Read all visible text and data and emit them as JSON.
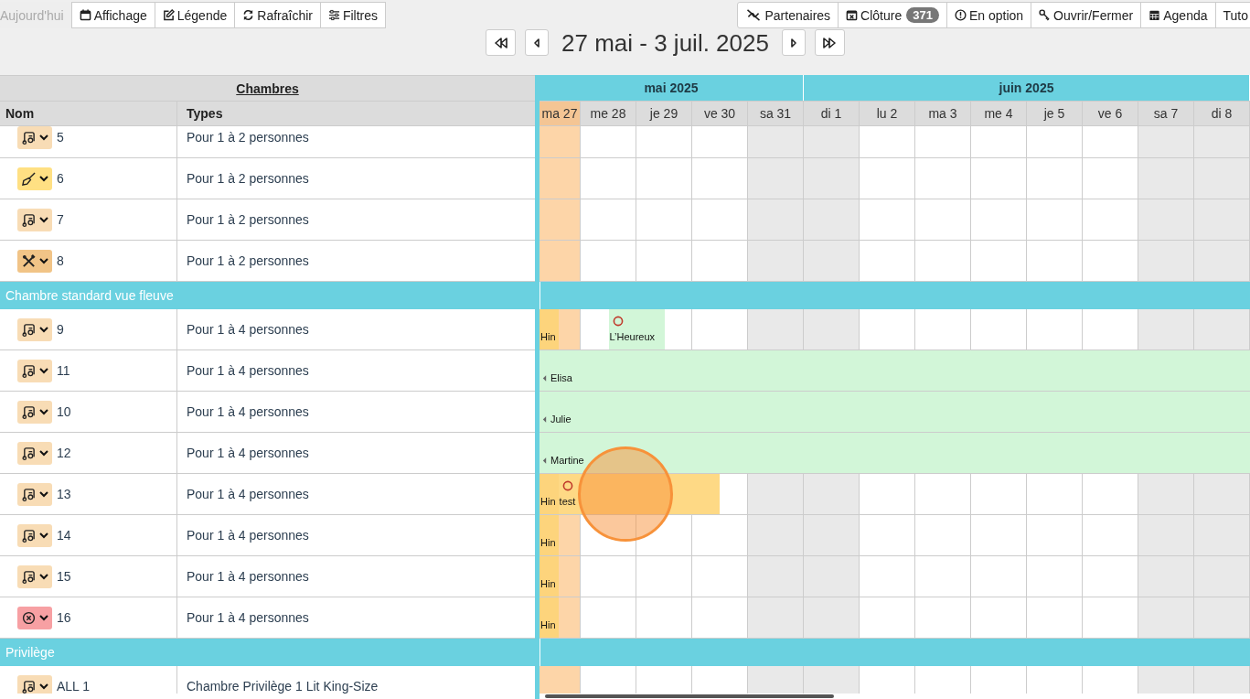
{
  "toolbar_left": [
    {
      "label": "Aujourd'hui",
      "disabled": true
    },
    {
      "label": "Affichage",
      "disabled": false
    },
    {
      "label": "Légende",
      "disabled": false
    },
    {
      "label": "Rafraîchir",
      "disabled": false
    },
    {
      "label": "Filtres",
      "disabled": false
    }
  ],
  "toolbar_right": [
    {
      "label": "Partenaires"
    },
    {
      "label": "Clôture",
      "badge": "371"
    },
    {
      "label": "En option"
    },
    {
      "label": "Ouvrir/Fermer"
    },
    {
      "label": "Agenda"
    },
    {
      "label": "Tuto"
    }
  ],
  "period": {
    "title": "27 mai - 3 juil. 2025"
  },
  "table": {
    "title": "Chambres",
    "columns": [
      "Nom",
      "Types"
    ]
  },
  "months": [
    {
      "label": "mai 2025",
      "days": [
        {
          "label": "ma 27",
          "today": true,
          "weekend": false
        },
        {
          "label": "me 28",
          "today": false,
          "weekend": false
        },
        {
          "label": "je 29",
          "today": false,
          "weekend": false
        },
        {
          "label": "ve 30",
          "today": false,
          "weekend": false
        },
        {
          "label": "sa 31",
          "today": false,
          "weekend": true
        }
      ]
    },
    {
      "label": "juin 2025",
      "days": [
        {
          "label": "di 1",
          "today": false,
          "weekend": true
        },
        {
          "label": "lu 2",
          "today": false,
          "weekend": false
        },
        {
          "label": "ma 3",
          "today": false,
          "weekend": false
        },
        {
          "label": "me 4",
          "today": false,
          "weekend": false
        },
        {
          "label": "je 5",
          "today": false,
          "weekend": false
        },
        {
          "label": "ve 6",
          "today": false,
          "weekend": false
        },
        {
          "label": "sa 7",
          "today": false,
          "weekend": true
        },
        {
          "label": "di 8",
          "today": false,
          "weekend": true
        }
      ]
    }
  ],
  "rows": [
    {
      "kind": "room",
      "name": "5",
      "type": "Pour 1 à 2 personnes",
      "status": {
        "kind": "vacuum",
        "color": "#f8dcb5"
      },
      "bookings": []
    },
    {
      "kind": "room",
      "name": "6",
      "type": "Pour 1 à 2 personnes",
      "status": {
        "kind": "broom",
        "color": "#ffe083"
      },
      "bookings": []
    },
    {
      "kind": "room",
      "name": "7",
      "type": "Pour 1 à 2 personnes",
      "status": {
        "kind": "vacuum",
        "color": "#f8dcb5"
      },
      "bookings": []
    },
    {
      "kind": "room",
      "name": "8",
      "type": "Pour 1 à 2 personnes",
      "status": {
        "kind": "tools",
        "color": "#f1c487"
      },
      "bookings": []
    },
    {
      "kind": "group",
      "label": "Chambre standard vue fleuve"
    },
    {
      "kind": "room",
      "name": "9",
      "type": "Pour 1 à 4 personnes",
      "status": {
        "kind": "vacuum",
        "color": "#f8dcb5"
      },
      "bookings": [
        {
          "label": "Hin",
          "color": "#fdd47c",
          "option": false,
          "continues_before": false
        },
        {
          "label": "L’Heureux",
          "color": "#d2f6d8",
          "option": true,
          "continues_before": false
        }
      ]
    },
    {
      "kind": "room",
      "name": "11",
      "type": "Pour 1 à 4 personnes",
      "status": {
        "kind": "vacuum",
        "color": "#f8dcb5"
      },
      "bookings": [
        {
          "label": "Elisa",
          "color": "#d2f6d8",
          "option": false,
          "continues_before": true
        }
      ]
    },
    {
      "kind": "room",
      "name": "10",
      "type": "Pour 1 à 4 personnes",
      "status": {
        "kind": "vacuum",
        "color": "#f8dcb5"
      },
      "bookings": [
        {
          "label": "Julie",
          "color": "#d2f6d8",
          "option": false,
          "continues_before": true
        }
      ]
    },
    {
      "kind": "room",
      "name": "12",
      "type": "Pour 1 à 4 personnes",
      "status": {
        "kind": "vacuum",
        "color": "#f8dcb5"
      },
      "bookings": [
        {
          "label": "Martine",
          "color": "#d2f6d8",
          "option": false,
          "continues_before": true
        }
      ]
    },
    {
      "kind": "room",
      "name": "13",
      "type": "Pour 1 à 4 personnes",
      "status": {
        "kind": "vacuum",
        "color": "#f8dcb5"
      },
      "bookings": [
        {
          "label": "Hin",
          "color": "#fdd47c",
          "option": false,
          "continues_before": false
        },
        {
          "label": "test",
          "color": "#fed985",
          "option": true,
          "continues_before": false
        }
      ]
    },
    {
      "kind": "room",
      "name": "14",
      "type": "Pour 1 à 4 personnes",
      "status": {
        "kind": "vacuum",
        "color": "#f8dcb5"
      },
      "bookings": [
        {
          "label": "Hin",
          "color": "#fdd47c",
          "option": false,
          "continues_before": false
        }
      ]
    },
    {
      "kind": "room",
      "name": "15",
      "type": "Pour 1 à 4 personnes",
      "status": {
        "kind": "vacuum",
        "color": "#f8dcb5"
      },
      "bookings": [
        {
          "label": "Hin",
          "color": "#fdd47c",
          "option": false,
          "continues_before": false
        }
      ]
    },
    {
      "kind": "room",
      "name": "16",
      "type": "Pour 1 à 4 personnes",
      "status": {
        "kind": "closed",
        "color": "#f7a0a3"
      },
      "bookings": [
        {
          "label": "Hin",
          "color": "#fdd47c",
          "option": false,
          "continues_before": false
        }
      ]
    },
    {
      "kind": "group",
      "label": "Privilège"
    },
    {
      "kind": "room",
      "name": "ALL 1",
      "type": "Chambre Privilège 1 Lit King-Size",
      "status": {
        "kind": "vacuum",
        "color": "#f8dcb5"
      },
      "bookings": []
    }
  ],
  "touch_indicator": true
}
